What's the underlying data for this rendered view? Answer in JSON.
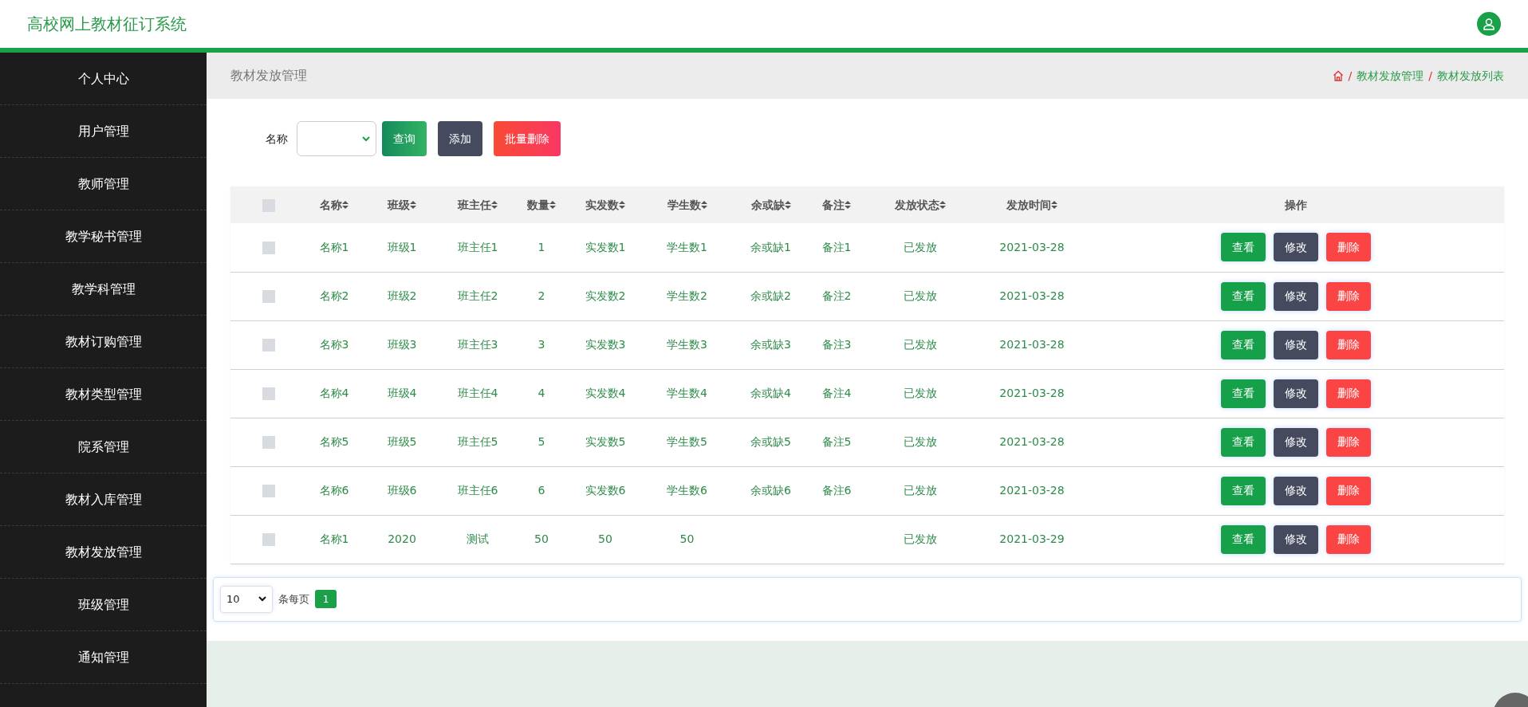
{
  "header": {
    "title": "高校网上教材征订系统"
  },
  "sidebar": {
    "items": [
      {
        "label": "个人中心"
      },
      {
        "label": "用户管理"
      },
      {
        "label": "教师管理"
      },
      {
        "label": "教学秘书管理"
      },
      {
        "label": "教学科管理"
      },
      {
        "label": "教材订购管理"
      },
      {
        "label": "教材类型管理"
      },
      {
        "label": "院系管理"
      },
      {
        "label": "教材入库管理"
      },
      {
        "label": "教材发放管理"
      },
      {
        "label": "班级管理"
      },
      {
        "label": "通知管理"
      }
    ]
  },
  "page_title": "教材发放管理",
  "breadcrumb": [
    {
      "separator": "/",
      "label": "教材发放管理"
    },
    {
      "separator": "/",
      "label": "教材发放列表"
    }
  ],
  "search": {
    "label": "名称",
    "buttons": [
      {
        "label": "查询",
        "kind": "query"
      },
      {
        "label": "添加",
        "kind": "add"
      },
      {
        "label": "批量删除",
        "kind": "delete"
      }
    ]
  },
  "table": {
    "select_all_checked": false,
    "columns": [
      {
        "label": "名称",
        "sortable": true
      },
      {
        "label": "班级",
        "sortable": true
      },
      {
        "label": "班主任",
        "sortable": true
      },
      {
        "label": "数量",
        "sortable": true
      },
      {
        "label": "实发数",
        "sortable": true
      },
      {
        "label": "学生数",
        "sortable": true
      },
      {
        "label": "余或缺",
        "sortable": true
      },
      {
        "label": "备注",
        "sortable": true
      },
      {
        "label": "发放状态",
        "sortable": true
      },
      {
        "label": "发放时间",
        "sortable": true
      },
      {
        "label": "操作",
        "sortable": false
      }
    ],
    "rows": [
      {
        "checked": false,
        "name": "名称1",
        "class": "班级1",
        "head_teacher": "班主任1",
        "quantity": "1",
        "issued": "实发数1",
        "students": "学生数1",
        "surplus": "余或缺1",
        "remark": "备注1",
        "status": "已发放",
        "date": "2021-03-28",
        "actions": [
          {
            "label": "查看",
            "kind": "view"
          },
          {
            "label": "修改",
            "kind": "edit"
          },
          {
            "label": "删除",
            "kind": "delete"
          }
        ]
      },
      {
        "checked": false,
        "name": "名称2",
        "class": "班级2",
        "head_teacher": "班主任2",
        "quantity": "2",
        "issued": "实发数2",
        "students": "学生数2",
        "surplus": "余或缺2",
        "remark": "备注2",
        "status": "已发放",
        "date": "2021-03-28",
        "actions": [
          {
            "label": "查看",
            "kind": "view"
          },
          {
            "label": "修改",
            "kind": "edit"
          },
          {
            "label": "删除",
            "kind": "delete"
          }
        ]
      },
      {
        "checked": false,
        "name": "名称3",
        "class": "班级3",
        "head_teacher": "班主任3",
        "quantity": "3",
        "issued": "实发数3",
        "students": "学生数3",
        "surplus": "余或缺3",
        "remark": "备注3",
        "status": "已发放",
        "date": "2021-03-28",
        "actions": [
          {
            "label": "查看",
            "kind": "view"
          },
          {
            "label": "修改",
            "kind": "edit"
          },
          {
            "label": "删除",
            "kind": "delete"
          }
        ]
      },
      {
        "checked": false,
        "name": "名称4",
        "class": "班级4",
        "head_teacher": "班主任4",
        "quantity": "4",
        "issued": "实发数4",
        "students": "学生数4",
        "surplus": "余或缺4",
        "remark": "备注4",
        "status": "已发放",
        "date": "2021-03-28",
        "actions": [
          {
            "label": "查看",
            "kind": "view"
          },
          {
            "label": "修改",
            "kind": "edit"
          },
          {
            "label": "删除",
            "kind": "delete"
          }
        ]
      },
      {
        "checked": false,
        "name": "名称5",
        "class": "班级5",
        "head_teacher": "班主任5",
        "quantity": "5",
        "issued": "实发数5",
        "students": "学生数5",
        "surplus": "余或缺5",
        "remark": "备注5",
        "status": "已发放",
        "date": "2021-03-28",
        "actions": [
          {
            "label": "查看",
            "kind": "view"
          },
          {
            "label": "修改",
            "kind": "edit"
          },
          {
            "label": "删除",
            "kind": "delete"
          }
        ]
      },
      {
        "checked": false,
        "name": "名称6",
        "class": "班级6",
        "head_teacher": "班主任6",
        "quantity": "6",
        "issued": "实发数6",
        "students": "学生数6",
        "surplus": "余或缺6",
        "remark": "备注6",
        "status": "已发放",
        "date": "2021-03-28",
        "actions": [
          {
            "label": "查看",
            "kind": "view"
          },
          {
            "label": "修改",
            "kind": "edit"
          },
          {
            "label": "删除",
            "kind": "delete"
          }
        ]
      },
      {
        "checked": false,
        "name": "名称1",
        "class": "2020",
        "head_teacher": "测试",
        "quantity": "50",
        "issued": "50",
        "students": "50",
        "status": "已发放",
        "date": "2021-03-29",
        "actions": [
          {
            "label": "查看",
            "kind": "view"
          },
          {
            "label": "修改",
            "kind": "edit"
          },
          {
            "label": "删除",
            "kind": "delete"
          }
        ]
      }
    ]
  },
  "pagination": {
    "page_size": "10",
    "page_size_label": "条每页",
    "pages": [
      {
        "label": "1",
        "selected": true
      }
    ]
  }
}
